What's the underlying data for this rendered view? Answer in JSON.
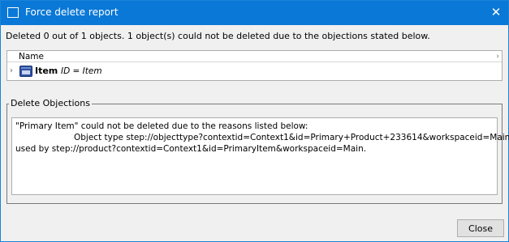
{
  "window": {
    "title": "Force delete report",
    "close_glyph": "✕"
  },
  "summary": "Deleted 0 out of 1 objects. 1 object(s) could not be deleted due to the objections stated below.",
  "grid": {
    "column_name": "Name",
    "header_arrow": "›",
    "rows": [
      {
        "expand_glyph": "›",
        "icon": "item-object-icon",
        "name": "Item",
        "id_text": "ID = Item"
      }
    ]
  },
  "objections": {
    "legend": "Delete Objections",
    "line1": "\"Primary Item\" could not be deleted due to the reasons listed below:",
    "line2": "Object type step://objecttype?contextid=Context1&id=Primary+Product+233614&workspaceid=Main is",
    "line3": "used by step://product?contextid=Context1&id=PrimaryItem&workspaceid=Main."
  },
  "buttons": {
    "close_label": "Close"
  },
  "colors": {
    "titlebar": "#0a78d7",
    "window_bg": "#f0f0f0",
    "item_icon": "#2f52a0"
  }
}
